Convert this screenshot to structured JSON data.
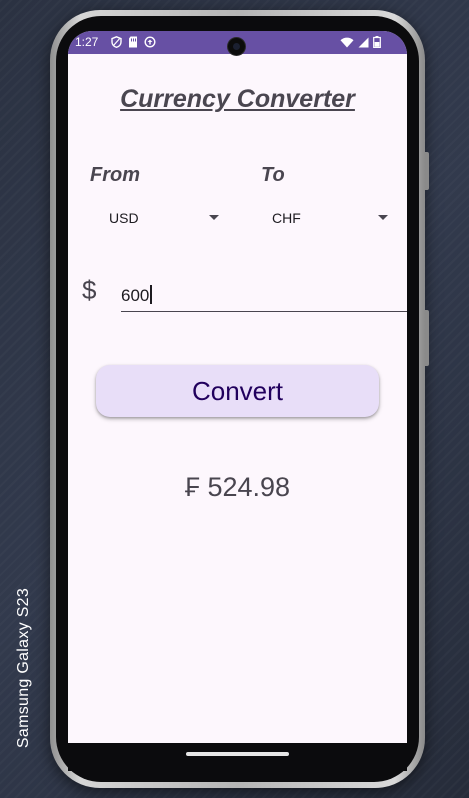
{
  "device": {
    "label": "Samsung Galaxy  S23"
  },
  "status_bar": {
    "time": "1:27",
    "background": "#6750a4",
    "left_icons": [
      "shield-icon",
      "sim-card-icon",
      "sync-icon"
    ],
    "right_icons": [
      "wifi-icon",
      "signal-icon",
      "battery-icon"
    ]
  },
  "app": {
    "title": "Currency Converter",
    "from_label": "From",
    "to_label": "To",
    "from_currency": "USD",
    "to_currency": "CHF",
    "currency_symbol": "$",
    "amount_value": "600",
    "convert_label": "Convert",
    "result": "₣ 524.98"
  },
  "colors": {
    "accent": "#6750a4",
    "button_bg": "#e8def8",
    "button_text": "#21005d",
    "screen_bg": "#fdf7fd"
  }
}
